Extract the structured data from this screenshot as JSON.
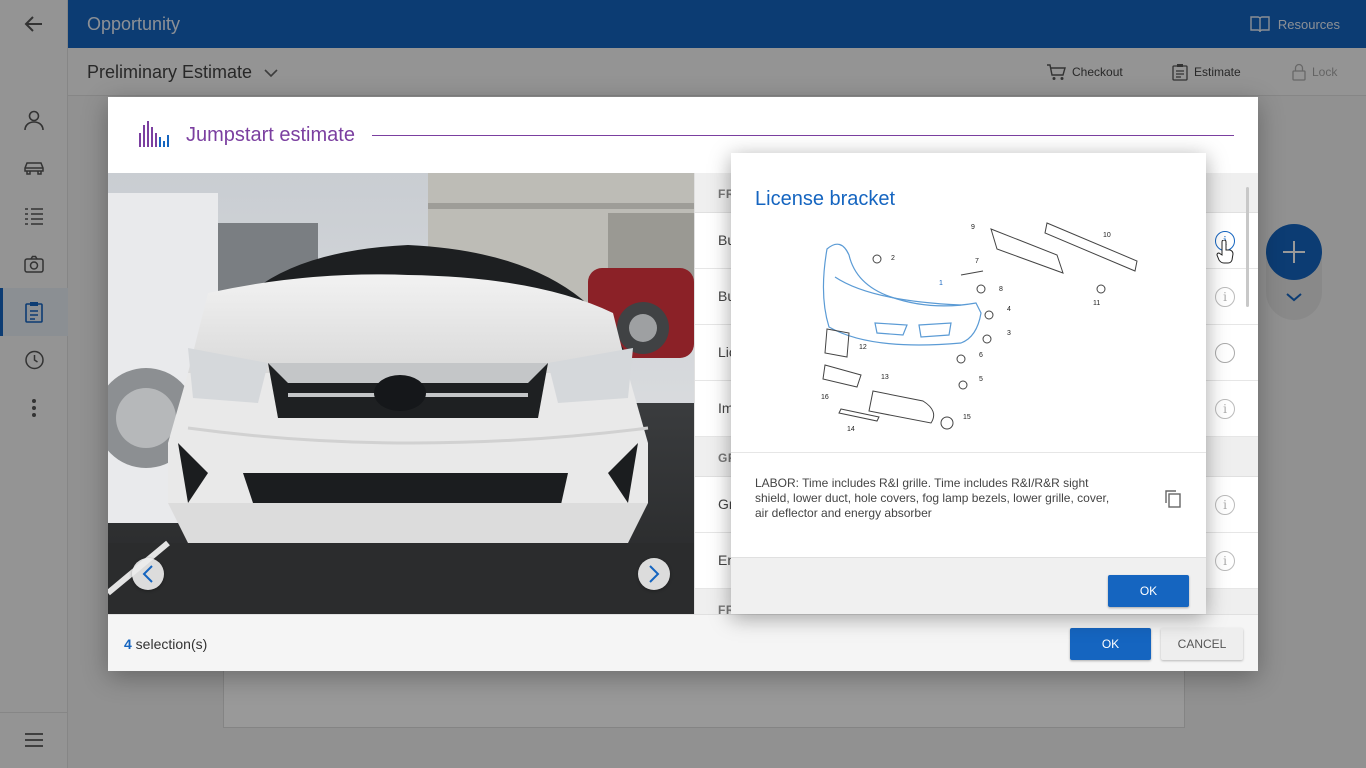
{
  "topbar": {
    "title": "Opportunity",
    "resources_label": "Resources"
  },
  "subbar": {
    "title": "Preliminary Estimate",
    "checkout_label": "Checkout",
    "estimate_label": "Estimate",
    "lock_label": "Lock"
  },
  "dialog": {
    "title": "Jumpstart estimate",
    "list": {
      "sections": [
        "FR",
        "GR",
        "FR"
      ],
      "rows": [
        {
          "label": "Bu",
          "control": "info-active"
        },
        {
          "label": "Bu",
          "control": "info"
        },
        {
          "label": "Lic",
          "control": "radio"
        },
        {
          "label": "Im",
          "control": "info"
        },
        {
          "label": "Gr",
          "control": "info"
        },
        {
          "label": "En",
          "control": "info"
        }
      ]
    },
    "footer": {
      "selection_count": "4",
      "selection_suffix": " selection(s)",
      "ok_label": "OK",
      "cancel_label": "CANCEL"
    }
  },
  "popup": {
    "title": "License bracket",
    "diagram_callouts": [
      "1",
      "2",
      "3",
      "4",
      "5",
      "6",
      "7",
      "8",
      "9",
      "10",
      "11",
      "12",
      "13",
      "14",
      "15",
      "16"
    ],
    "description": "LABOR: Time includes R&I grille. Time includes R&I/R&R sight shield, lower duct, hole covers, fog lamp bezels, lower grille, cover, air deflector and energy absorber",
    "ok_label": "OK"
  },
  "colors": {
    "primary": "#1565c0",
    "accent_purple": "#7b3fa0"
  }
}
